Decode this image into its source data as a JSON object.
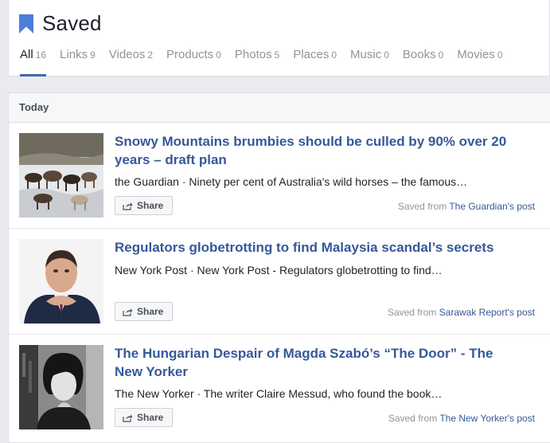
{
  "header": {
    "title": "Saved",
    "icon": "bookmark-icon",
    "accent_color": "#4267b2"
  },
  "tabs": [
    {
      "label": "All",
      "count": "16",
      "active": true
    },
    {
      "label": "Links",
      "count": "9"
    },
    {
      "label": "Videos",
      "count": "2"
    },
    {
      "label": "Products",
      "count": "0"
    },
    {
      "label": "Photos",
      "count": "5"
    },
    {
      "label": "Places",
      "count": "0"
    },
    {
      "label": "Music",
      "count": "0"
    },
    {
      "label": "Books",
      "count": "0"
    },
    {
      "label": "Movies",
      "count": "0"
    }
  ],
  "section": {
    "title": "Today"
  },
  "items": [
    {
      "title": "Snowy Mountains brumbies should be culled by 90% over 20 years – draft plan",
      "description": "the Guardian · Ninety per cent of Australia's wild horses – the famous…",
      "share_label": "Share",
      "saved_prefix": "Saved from ",
      "saved_source": "The Guardian's post",
      "thumb": "wild horses in snow"
    },
    {
      "title": "Regulators globetrotting to find Malaysia scandal’s secrets",
      "description": "New York Post · New York Post - Regulators globetrotting to find…",
      "share_label": "Share",
      "saved_prefix": "Saved from ",
      "saved_source": "Sarawak Report's post",
      "thumb": "man in suit portrait"
    },
    {
      "title": "The Hungarian Despair of Magda Szabó’s “The Door” - The New Yorker",
      "description": "The New Yorker · The writer Claire Messud, who found the book…",
      "share_label": "Share",
      "saved_prefix": "Saved from ",
      "saved_source": "The New Yorker's post",
      "thumb": "black and white portrait of woman"
    }
  ],
  "colors": {
    "link": "#365899",
    "muted": "#90949c",
    "background": "#e9ebee"
  }
}
